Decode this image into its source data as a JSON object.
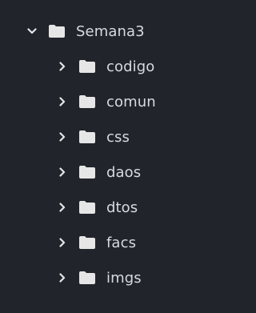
{
  "tree": {
    "root": {
      "label": "Semana3",
      "expanded": true,
      "icon": "chevron-down-icon",
      "folder_icon": "folder-icon"
    },
    "children": [
      {
        "label": "codigo",
        "expanded": false
      },
      {
        "label": "comun",
        "expanded": false
      },
      {
        "label": "css",
        "expanded": false
      },
      {
        "label": "daos",
        "expanded": false
      },
      {
        "label": "dtos",
        "expanded": false
      },
      {
        "label": "facs",
        "expanded": false
      },
      {
        "label": "imgs",
        "expanded": false
      }
    ]
  },
  "colors": {
    "background": "#21252b",
    "text": "#d7dae0",
    "folder": "#e6e6e6",
    "chevron": "#e6e6e6"
  }
}
